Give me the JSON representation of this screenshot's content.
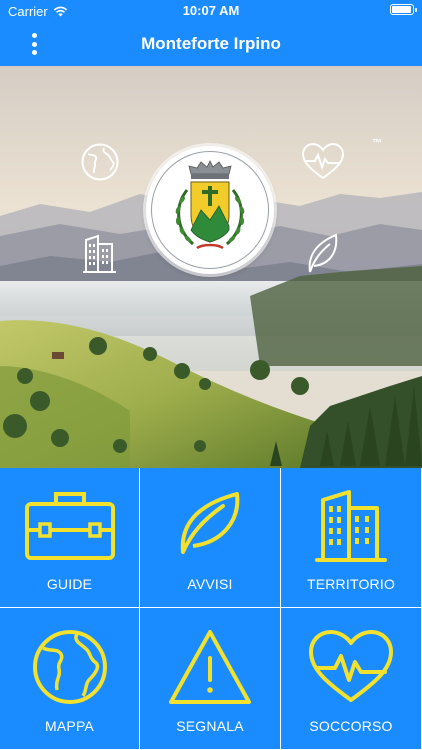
{
  "status_bar": {
    "carrier": "Carrier",
    "time": "10:07 AM"
  },
  "header": {
    "title": "Monteforte Irpino",
    "menu_icon": "more-vertical-icon"
  },
  "hero": {
    "trademark": "™",
    "icons": [
      "globe-icon",
      "heartbeat-icon",
      "building-icon",
      "leaf-icon"
    ],
    "crest": "coat-of-arms"
  },
  "tiles": [
    {
      "label": "GUIDE",
      "icon": "briefcase-icon"
    },
    {
      "label": "AVVISI",
      "icon": "leaf-icon"
    },
    {
      "label": "TERRITORIO",
      "icon": "building-icon"
    },
    {
      "label": "MAPPA",
      "icon": "globe-icon"
    },
    {
      "label": "SEGNALA",
      "icon": "warning-icon"
    },
    {
      "label": "SOCCORSO",
      "icon": "heartbeat-icon"
    }
  ],
  "colors": {
    "primary": "#1a8cff",
    "icon_yellow": "#f2e22e",
    "white": "#ffffff"
  }
}
